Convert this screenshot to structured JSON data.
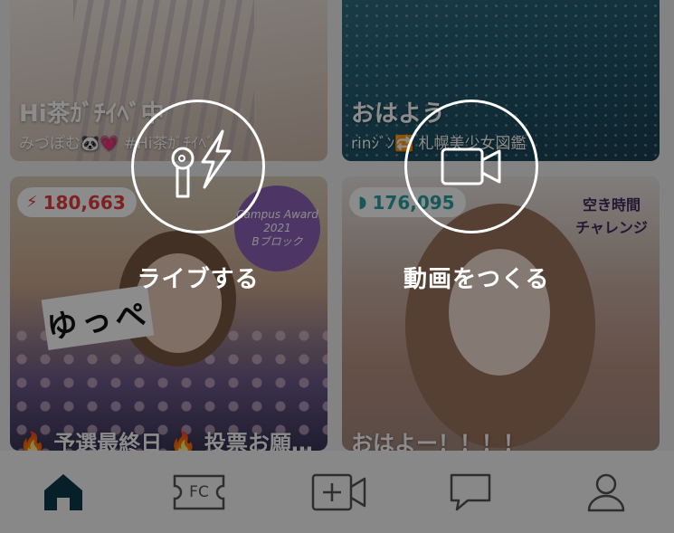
{
  "feed": {
    "cards": [
      {
        "title": "Hi茶ｶﾞﾁｲﾍﾞ中",
        "subtitle": "みづぽむ🐼💗 #Hi茶ｶﾞﾁｲﾍﾞ"
      },
      {
        "title": "おはよう",
        "subtitle": "rinｼﾞﾝ🔁 札幌美少女図鑑"
      },
      {
        "title": "🔥 予選最終日 🔥 投票お願…",
        "badge_value": "180,663",
        "badge_icon": "lightning-icon",
        "circle_text": [
          "Campus Award",
          "2021",
          "Bブロック"
        ],
        "sign_text": "ゆっぺ"
      },
      {
        "title": "おはよー！！！！",
        "badge_value": "176,095",
        "badge_icon": "signal-icon",
        "tag_text": [
          "空き時間",
          "チャレンジ"
        ]
      }
    ]
  },
  "actions": {
    "live": {
      "label": "ライブする"
    },
    "video": {
      "label": "動画をつくる"
    }
  },
  "tabbar": {
    "fc_label": "FC",
    "active_color": "#0d3a4a",
    "inactive_color": "#555555"
  },
  "colors": {
    "badge_red": "#e83c3c",
    "badge_teal": "#2aa3a0"
  }
}
